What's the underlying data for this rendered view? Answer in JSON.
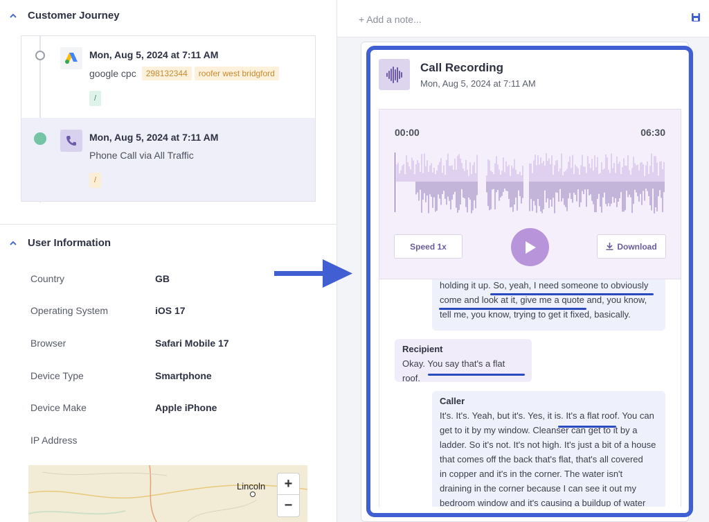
{
  "left": {
    "journey": {
      "title": "Customer Journey",
      "items": [
        {
          "date": "Mon, Aug 5, 2024 at 7:11 AM",
          "source": "google cpc",
          "tags": [
            "298132344",
            "roofer west bridgford"
          ],
          "path": "/",
          "icon": "google-ads-icon"
        },
        {
          "date": "Mon, Aug 5, 2024 at 7:11 AM",
          "source": "Phone Call via All Traffic",
          "tags": [],
          "path": "/",
          "icon": "phone-icon"
        }
      ]
    },
    "user_info": {
      "title": "User Information",
      "rows": [
        {
          "label": "Country",
          "value": "GB"
        },
        {
          "label": "Operating System",
          "value": "iOS 17"
        },
        {
          "label": "Browser",
          "value": "Safari Mobile 17"
        },
        {
          "label": "Device Type",
          "value": "Smartphone"
        },
        {
          "label": "Device Make",
          "value": "Apple iPhone"
        },
        {
          "label": "IP Address",
          "value": ""
        }
      ]
    },
    "map": {
      "city": "Lincoln",
      "zoom_in": "+",
      "zoom_out": "−"
    }
  },
  "right": {
    "note_placeholder": "+ Add a note...",
    "recording": {
      "title": "Call Recording",
      "date": "Mon, Aug 5, 2024 at 7:11 AM",
      "time_start": "00:00",
      "time_end": "06:30",
      "speed_label": "Speed 1x",
      "download_label": "Download"
    },
    "transcript": [
      {
        "speaker": "",
        "lines": [
          "holding it up. So, yeah, I need someone to obviously",
          "come and look at it, give me a quote and, you know,",
          "tell me, you know, trying to get it fixed, basically."
        ]
      },
      {
        "speaker": "Recipient",
        "lines": [
          "Okay. You say that's a flat roof."
        ]
      },
      {
        "speaker": "Caller",
        "lines": [
          "It's. It's. Yeah, but it's. Yes, it is. It's a flat roof. You can",
          "get to it by my window. Cleanser can get to it by a",
          "ladder. So it's not. It's not high. It's just a bit of a house",
          "that comes off the back that's flat, that's all covered",
          "in copper and it's in the corner. The water isn't",
          "draining in the corner because I can see it out my",
          "bedroom window and it's causing a buildup of water"
        ]
      }
    ]
  },
  "colors": {
    "accent_blue": "#3f5fd3",
    "play_purple": "#b894db",
    "journey_green": "#74c5a6",
    "tag_orange": "#c98a2d"
  }
}
